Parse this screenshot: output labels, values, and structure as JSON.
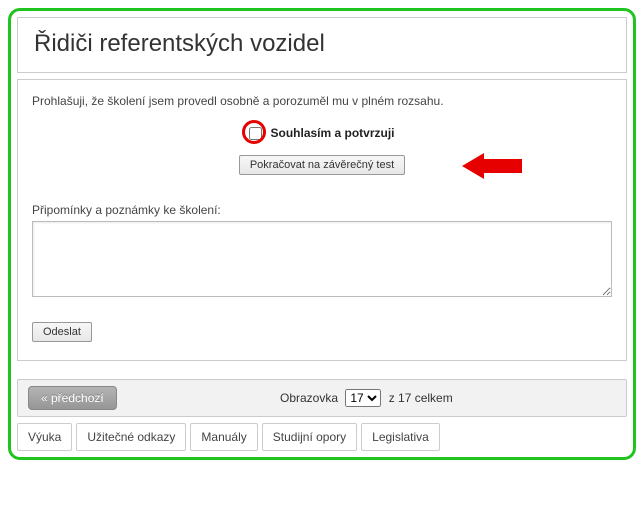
{
  "title": "Řidiči referentských vozidel",
  "declaration": "Prohlašuji, že školení jsem provedl osobně a porozuměl mu v plném rozsahu.",
  "confirm_label": "Souhlasím a potvrzuji",
  "continue_label": "Pokračovat na závěrečný test",
  "notes_label": "Připomínky a poznámky ke školení:",
  "notes_value": "",
  "send_label": "Odeslat",
  "pager": {
    "prev_label": "« předchozí",
    "screen_word": "Obrazovka",
    "current": "17",
    "of_text": "z 17 celkem"
  },
  "tabs": [
    "Výuka",
    "Užitečné odkazy",
    "Manuály",
    "Studijní opory",
    "Legislativa"
  ],
  "colors": {
    "frame": "#1fc41f",
    "highlight": "#e60000"
  }
}
